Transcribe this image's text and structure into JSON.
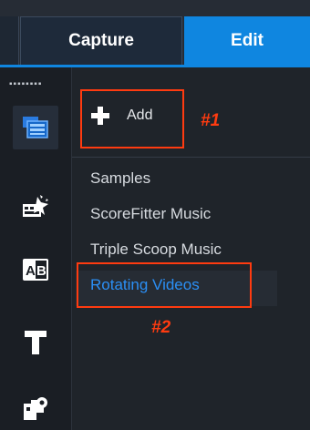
{
  "tabs": {
    "capture": "Capture",
    "edit": "Edit"
  },
  "rail": {
    "items": [
      {
        "icon": "media-library-icon",
        "active": true
      },
      {
        "icon": "transitions-icon",
        "active": false
      },
      {
        "icon": "titles-ab-icon",
        "active": false
      },
      {
        "icon": "text-icon",
        "active": false
      },
      {
        "icon": "graphics-icon",
        "active": false
      }
    ]
  },
  "library": {
    "add_label": "Add",
    "folders": [
      "Samples",
      "ScoreFitter Music",
      "Triple Scoop Music",
      "Rotating Videos"
    ],
    "selected_index": 3
  },
  "annotations": {
    "one": "#1",
    "two": "#2"
  },
  "colors": {
    "accent": "#0f86e0",
    "selected_text": "#2b8ff5",
    "annotation": "#ff3b10"
  }
}
